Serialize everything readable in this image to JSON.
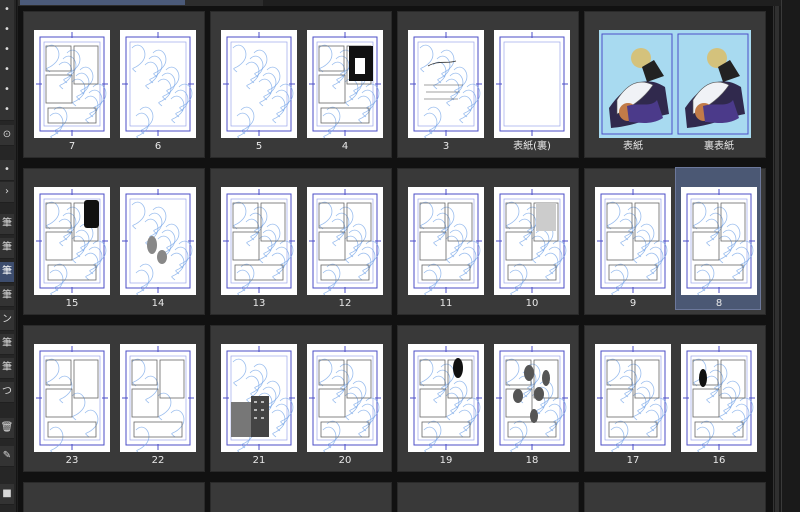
{
  "sidebar": {
    "buttons": [
      "筆",
      "筆",
      "筆",
      "筆",
      "ン",
      "筆",
      "筆",
      "つ"
    ]
  },
  "pages": [
    {
      "label": "7",
      "style": "sketch-frames"
    },
    {
      "label": "6",
      "style": "sketch-people"
    },
    {
      "label": "5",
      "style": "sketch-people"
    },
    {
      "label": "4",
      "style": "black-panel"
    },
    {
      "label": "3",
      "style": "text-page"
    },
    {
      "label": "表紙(裏)",
      "style": "blank-frame"
    },
    {
      "label": "表紙",
      "style": "cover"
    },
    {
      "label": "裏表紙",
      "style": "cover"
    },
    {
      "label": "15",
      "style": "sketch-black-top"
    },
    {
      "label": "14",
      "style": "sketch-dots"
    },
    {
      "label": "13",
      "style": "sketch-frames"
    },
    {
      "label": "12",
      "style": "sketch-frames"
    },
    {
      "label": "11",
      "style": "sketch-frames"
    },
    {
      "label": "10",
      "style": "sketch-gray"
    },
    {
      "label": "9",
      "style": "sketch-frames"
    },
    {
      "label": "8",
      "style": "sketch-blue"
    },
    {
      "label": "23",
      "style": "sparse-blue"
    },
    {
      "label": "22",
      "style": "sparse-blue"
    },
    {
      "label": "21",
      "style": "building"
    },
    {
      "label": "20",
      "style": "sketch-frames"
    },
    {
      "label": "19",
      "style": "black-oval"
    },
    {
      "label": "18",
      "style": "black-dots"
    },
    {
      "label": "17",
      "style": "sketch-frames"
    },
    {
      "label": "16",
      "style": "black-small"
    }
  ],
  "selected_page": "8",
  "colors": {
    "background": "#1f1f1f",
    "panel": "#393939",
    "selected": "#4b5874",
    "sketch": "#78a7e8",
    "guide": "#4b4ec7",
    "cover_bg": "#a8daf0"
  }
}
